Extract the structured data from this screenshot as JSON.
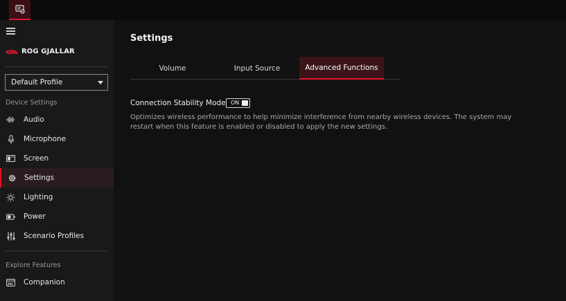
{
  "sidebar": {
    "brand": "ROG GJALLAR",
    "profile": {
      "selected": "Default Profile"
    },
    "device_settings_label": "Device Settings",
    "items": [
      {
        "label": "Audio",
        "icon": "audio-icon"
      },
      {
        "label": "Microphone",
        "icon": "microphone-icon"
      },
      {
        "label": "Screen",
        "icon": "screen-icon"
      },
      {
        "label": "Settings",
        "icon": "gear-icon",
        "active": true
      },
      {
        "label": "Lighting",
        "icon": "lighting-icon"
      },
      {
        "label": "Power",
        "icon": "battery-icon"
      },
      {
        "label": "Scenario Profiles",
        "icon": "sliders-icon"
      }
    ],
    "explore_label": "Explore Features",
    "explore_items": [
      {
        "label": "Companion",
        "icon": "companion-icon"
      }
    ]
  },
  "main": {
    "title": "Settings",
    "tabs": [
      {
        "label": "Volume"
      },
      {
        "label": "Input Source"
      },
      {
        "label": "Advanced Functions",
        "active": true
      }
    ],
    "setting": {
      "title": "Connection Stability Mode",
      "toggle_state": "ON",
      "description": "Optimizes wireless performance to help minimize interference from nearby wireless devices. The system may restart when this feature is enabled or disabled to apply the new settings."
    }
  },
  "colors": {
    "accent": "#e2132d",
    "sidebar_bg": "#191919",
    "main_bg": "#111111",
    "topbar_bg": "#0b0b0b"
  }
}
